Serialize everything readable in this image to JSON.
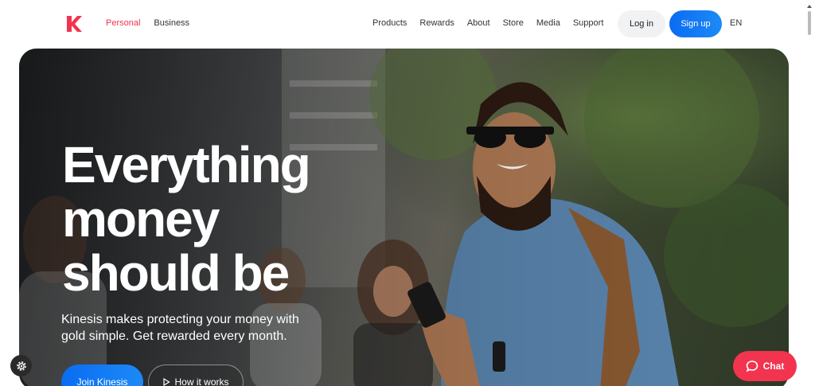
{
  "brand": {
    "logo_icon": "kinesis-k-logo",
    "accent": "#f2344e",
    "primary_blue": "#0a6cf2"
  },
  "nav": {
    "segments": [
      {
        "label": "Personal",
        "active": true
      },
      {
        "label": "Business",
        "active": false
      }
    ],
    "links": [
      "Products",
      "Rewards",
      "About",
      "Store",
      "Media",
      "Support"
    ],
    "login_label": "Log in",
    "signup_label": "Sign up",
    "language": "EN"
  },
  "hero": {
    "headline_lines": [
      "Everything",
      "money",
      "should be"
    ],
    "subtitle": "Kinesis makes protecting your money with gold simple. Get rewarded every month.",
    "primary_cta": "Join Kinesis",
    "secondary_cta": "How it works",
    "secondary_icon": "play-icon"
  },
  "widgets": {
    "settings_icon": "gear-icon",
    "chat_label": "Chat",
    "chat_icon": "chat-bubble-icon"
  }
}
